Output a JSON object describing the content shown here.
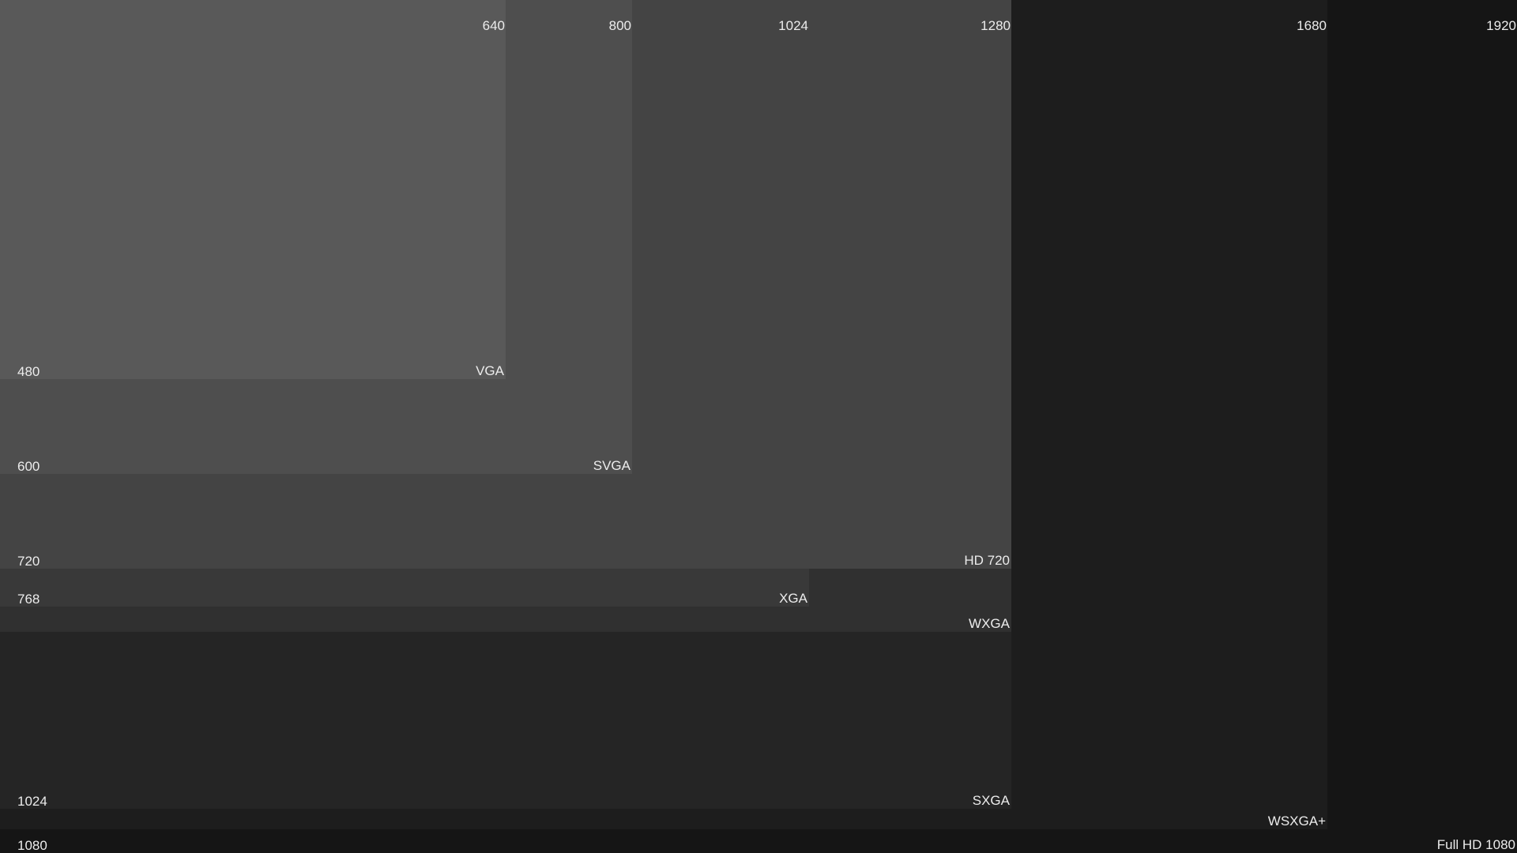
{
  "resolutions": [
    {
      "name": "Full HD 1080",
      "w": 1920,
      "h": 1080,
      "color": "#151515"
    },
    {
      "name": "WSXGA+",
      "w": 1680,
      "h": 1050,
      "color": "#1d1d1d"
    },
    {
      "name": "SXGA",
      "w": 1280,
      "h": 1024,
      "color": "#252525"
    },
    {
      "name": "WXGA",
      "w": 1280,
      "h": 800,
      "color": "#303030"
    },
    {
      "name": "XGA",
      "w": 1024,
      "h": 768,
      "color": "#393939"
    },
    {
      "name": "HD 720",
      "w": 1280,
      "h": 720,
      "color": "#444444"
    },
    {
      "name": "SVGA",
      "w": 800,
      "h": 600,
      "color": "#4e4e4e"
    },
    {
      "name": "VGA",
      "w": 640,
      "h": 480,
      "color": "#595959"
    }
  ],
  "width_labels": [
    "640",
    "800",
    "1024",
    "1280",
    "1680",
    "1920"
  ],
  "height_labels": [
    "480",
    "600",
    "720",
    "768",
    "1024",
    "1080"
  ],
  "ruler": {
    "top_max": 1920,
    "left_max": 1080,
    "step": 50
  }
}
